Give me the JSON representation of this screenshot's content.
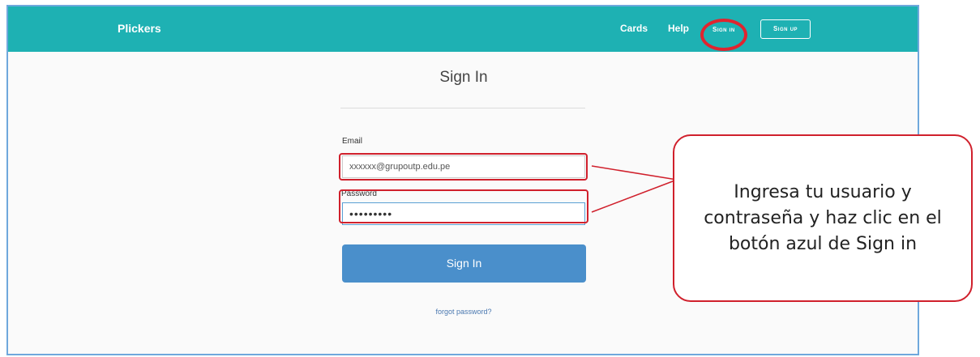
{
  "navbar": {
    "brand": "Plickers",
    "links": {
      "cards": "Cards",
      "help": "Help"
    },
    "sign_in": "Sign in",
    "sign_up": "Sign up"
  },
  "form": {
    "title": "Sign In",
    "email_label": "Email",
    "email_value": "xxxxxx@grupoutp.edu.pe",
    "password_label": "Password",
    "password_value": "•••••••••",
    "submit_label": "Sign In",
    "forgot_link": "forgot password?"
  },
  "annotation": {
    "callout_text": "Ingresa tu usuario y contraseña y haz clic en el botón azul de Sign in",
    "highlight_color": "#d0202c"
  },
  "colors": {
    "navbar": "#1eb1b3",
    "button": "#4a8fcb"
  }
}
